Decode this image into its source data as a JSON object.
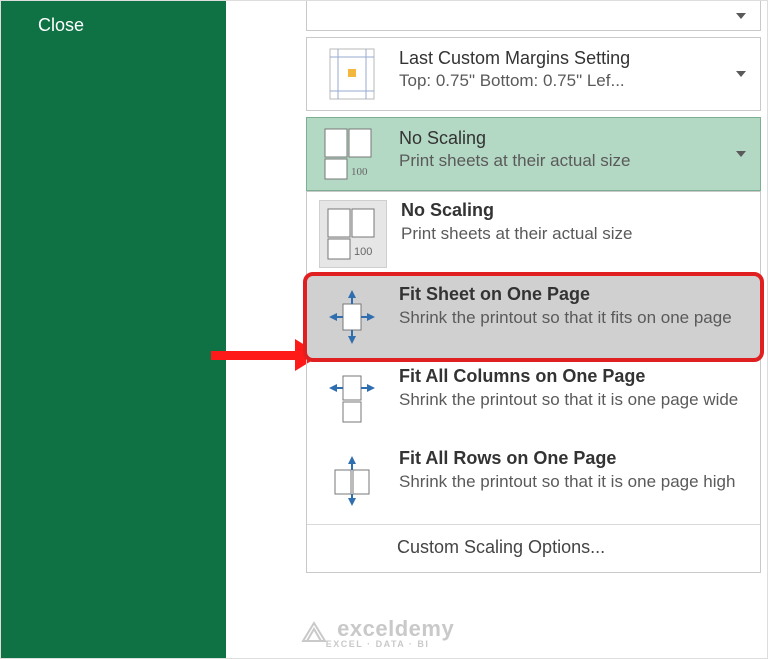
{
  "backstage": {
    "close_label": "Close"
  },
  "partial_top_row": {
    "subtitle_fragment": ""
  },
  "margins": {
    "title": "Last Custom Margins Setting",
    "subtitle": "Top: 0.75\" Bottom: 0.75\" Lef..."
  },
  "scaling_current": {
    "title": "No Scaling",
    "subtitle": "Print sheets at their actual size",
    "icon_label_small": "100"
  },
  "scaling_options": [
    {
      "title": "No Scaling",
      "subtitle": "Print sheets at their actual size",
      "icon_label_small": "100"
    },
    {
      "title": "Fit Sheet on One Page",
      "subtitle": "Shrink the printout so that it fits on one page"
    },
    {
      "title": "Fit All Columns on One Page",
      "subtitle": "Shrink the printout so that it is one page wide"
    },
    {
      "title": "Fit All Rows on One Page",
      "subtitle": "Shrink the printout so that it is one page high"
    }
  ],
  "custom_scaling_label": "Custom Scaling Options...",
  "watermark": {
    "brand": "exceldemy",
    "tag": "EXCEL · DATA · BI"
  }
}
